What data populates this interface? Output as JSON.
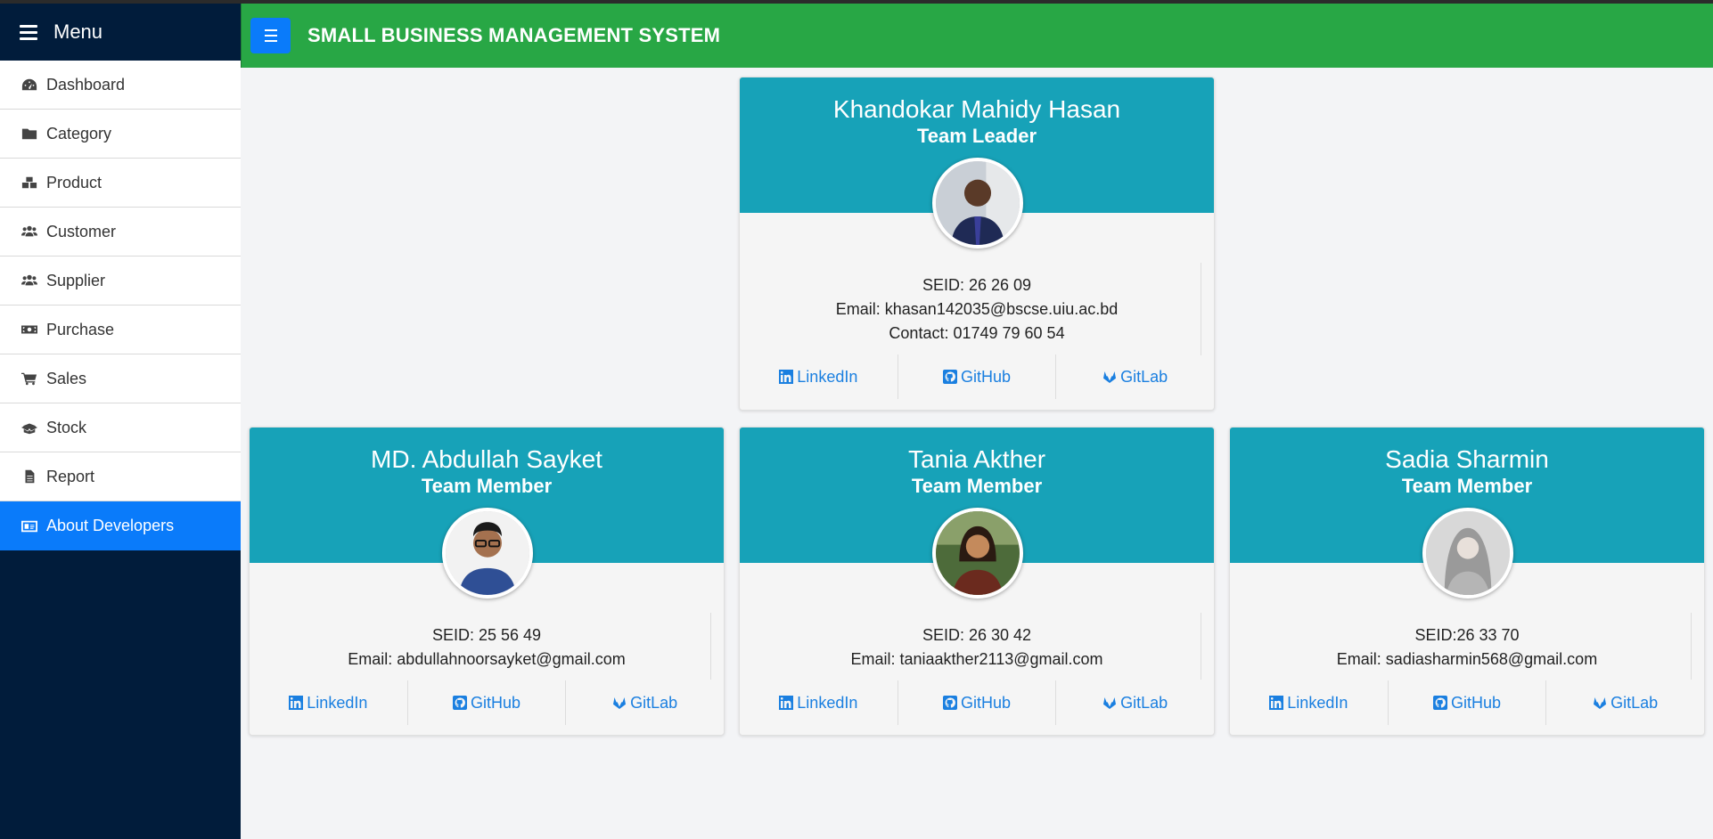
{
  "sidebar": {
    "title": "Menu",
    "items": [
      {
        "label": "Dashboard",
        "icon": "dashboard-icon"
      },
      {
        "label": "Category",
        "icon": "folder-icon"
      },
      {
        "label": "Product",
        "icon": "boxes-icon"
      },
      {
        "label": "Customer",
        "icon": "users-icon"
      },
      {
        "label": "Supplier",
        "icon": "users-icon"
      },
      {
        "label": "Purchase",
        "icon": "money-icon"
      },
      {
        "label": "Sales",
        "icon": "cart-icon"
      },
      {
        "label": "Stock",
        "icon": "box-open-icon"
      },
      {
        "label": "Report",
        "icon": "file-icon"
      },
      {
        "label": "About Developers",
        "icon": "id-card-icon",
        "active": true
      }
    ]
  },
  "header": {
    "title": "SMALL BUSINESS MANAGEMENT SYSTEM"
  },
  "colors": {
    "sidebar_bg": "#011c3b",
    "header_bg": "#28a745",
    "active_item": "#0a7bfa",
    "card_header": "#17a2b8",
    "link": "#1a7fe0"
  },
  "developers": [
    {
      "name": "Khandokar Mahidy Hasan",
      "role": "Team Leader",
      "seid": "SEID: 26 26 09",
      "email": "Email: khasan142035@bscse.uiu.ac.bd",
      "contact": "Contact: 01749 79 60 54"
    },
    {
      "name": "MD. Abdullah Sayket",
      "role": "Team Member",
      "seid": "SEID: 25 56 49",
      "email": "Email: abdullahnoorsayket@gmail.com"
    },
    {
      "name": "Tania Akther",
      "role": "Team Member",
      "seid": "SEID: 26 30 42",
      "email": "Email: taniaakther2113@gmail.com"
    },
    {
      "name": "Sadia Sharmin",
      "role": "Team Member",
      "seid": "SEID:26 33 70",
      "email": "Email: sadiasharmin568@gmail.com"
    }
  ],
  "links": {
    "linkedin": "LinkedIn",
    "github": "GitHub",
    "gitlab": "GitLab"
  }
}
